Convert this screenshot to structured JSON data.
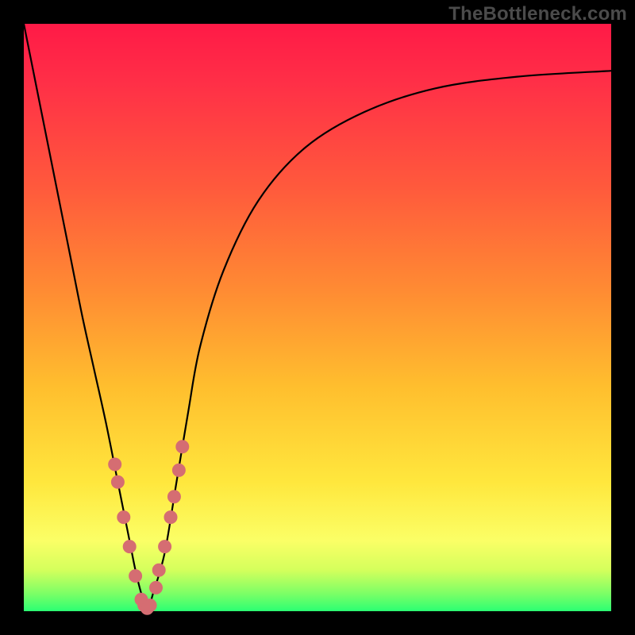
{
  "watermark": "TheBottleneck.com",
  "colors": {
    "gradient_top": "#ff1a47",
    "gradient_mid1": "#ff8a33",
    "gradient_mid2": "#ffe73d",
    "gradient_bottom": "#2bff73",
    "frame": "#000000",
    "curve": "#000000",
    "dots": "#d56d72"
  },
  "chart_data": {
    "type": "line",
    "title": "",
    "xlabel": "",
    "ylabel": "",
    "xlim": [
      0,
      100
    ],
    "ylim": [
      0,
      100
    ],
    "grid": false,
    "legend": false,
    "annotations": [
      "TheBottleneck.com"
    ],
    "series": [
      {
        "name": "bottleneck-curve",
        "x": [
          0,
          2,
          4,
          6,
          8,
          10,
          12,
          14,
          16,
          18,
          19,
          20,
          21,
          22,
          24,
          26,
          28,
          30,
          34,
          40,
          48,
          58,
          70,
          84,
          100
        ],
        "y": [
          100,
          90,
          80,
          70,
          60,
          50,
          41,
          32,
          22,
          12,
          7,
          3,
          0,
          3,
          10,
          22,
          34,
          45,
          58,
          70,
          79,
          85,
          89,
          91,
          92
        ]
      }
    ],
    "scatter_points": {
      "name": "highlighted-points",
      "x": [
        15.5,
        16.0,
        17.0,
        18.0,
        19.0,
        20.0,
        20.5,
        21.0,
        21.5,
        22.5,
        23.0,
        24.0,
        25.0,
        25.6,
        26.4,
        27.0
      ],
      "y": [
        25.0,
        22.0,
        16.0,
        11.0,
        6.0,
        2.0,
        1.0,
        0.5,
        1.0,
        4.0,
        7.0,
        11.0,
        16.0,
        19.5,
        24.0,
        28.0
      ]
    }
  }
}
